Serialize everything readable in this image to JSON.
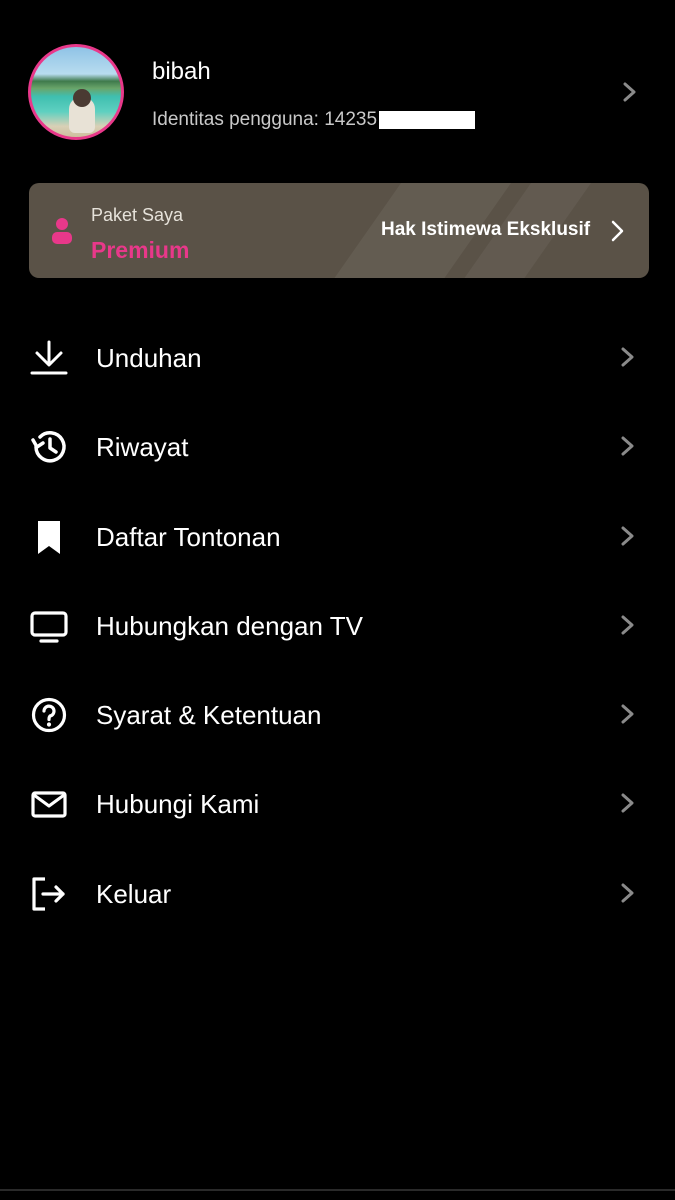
{
  "profile": {
    "username": "bibah",
    "user_id_label": "Identitas pengguna: 14235",
    "user_id_redacted": true
  },
  "plan": {
    "label": "Paket Saya",
    "value": "Premium",
    "link_label": "Hak Istimewa Eksklusif"
  },
  "menu": {
    "items": [
      {
        "label": "Unduhan",
        "icon": "download-icon"
      },
      {
        "label": "Riwayat",
        "icon": "history-icon"
      },
      {
        "label": "Daftar Tontonan",
        "icon": "bookmark-icon"
      },
      {
        "label": "Hubungkan dengan TV",
        "icon": "tv-icon"
      },
      {
        "label": "Syarat & Ketentuan",
        "icon": "help-circle-icon"
      },
      {
        "label": "Hubungi Kami",
        "icon": "mail-icon"
      },
      {
        "label": "Keluar",
        "icon": "logout-icon"
      }
    ]
  },
  "colors": {
    "background": "#000000",
    "accent": "#e8388a",
    "plan_card": "#5a5247",
    "chevron": "#8a8a8a",
    "secondary_text": "#c9c9c9"
  }
}
